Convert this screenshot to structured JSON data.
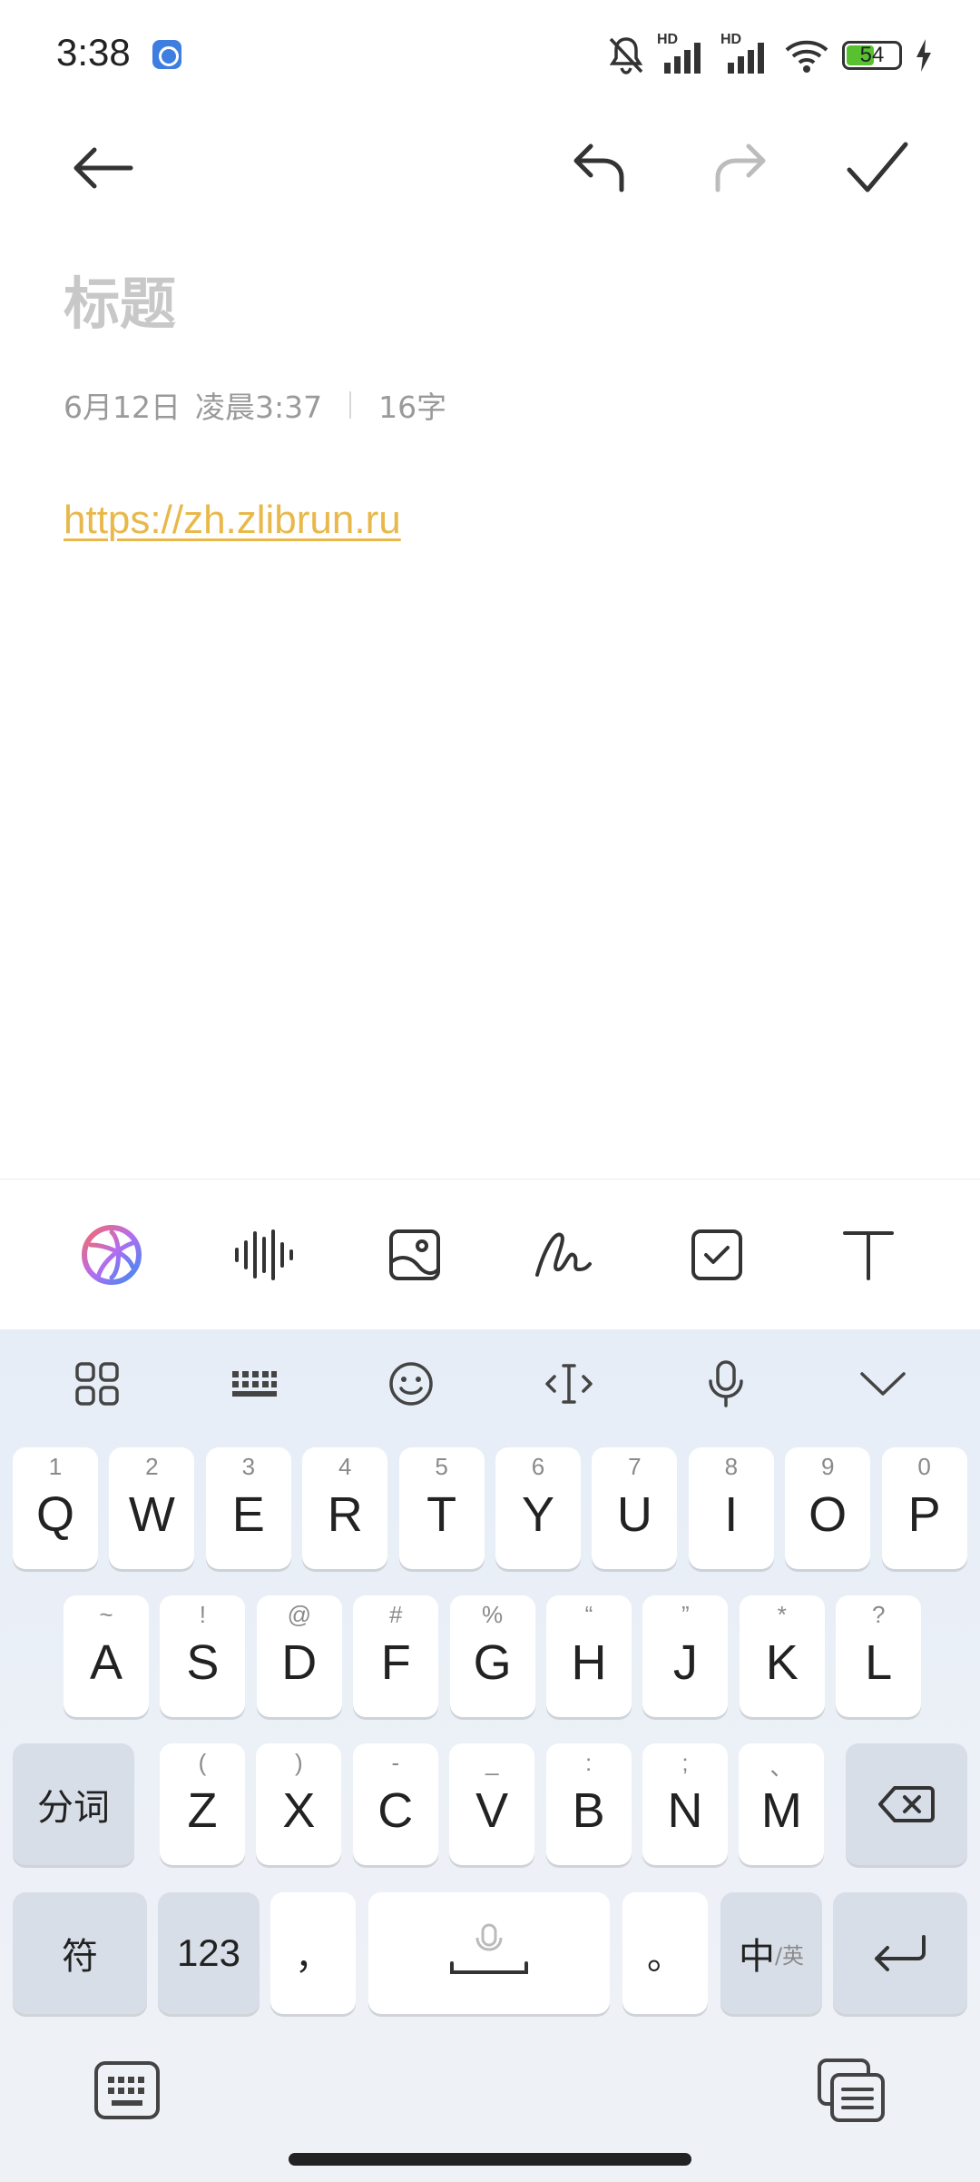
{
  "status_bar": {
    "time": "3:38",
    "battery": "54",
    "icons": [
      "app-icon",
      "bell-off-icon",
      "signal-icon",
      "signal-icon",
      "wifi-icon",
      "battery-icon",
      "charging-icon"
    ],
    "signal_labels": [
      "HD",
      "HD"
    ]
  },
  "toolbar": {
    "icons": [
      "back-arrow-icon",
      "undo-icon",
      "redo-icon",
      "check-icon"
    ]
  },
  "note": {
    "title_placeholder": "标题",
    "date": "6月12日",
    "time": "凌晨3:37",
    "char_count": "16字",
    "body_link": "https://zh.zlibrun.ru"
  },
  "edit_tools": [
    "ai-assistant-icon",
    "voice-wave-icon",
    "image-icon",
    "handwriting-icon",
    "checklist-icon",
    "text-format-icon"
  ],
  "keyboard": {
    "top_icons": [
      "grid-menu-icon",
      "keyboard-layout-icon",
      "emoji-icon",
      "cursor-icon",
      "microphone-icon",
      "collapse-icon"
    ],
    "row1": [
      {
        "k": "Q",
        "s": "1"
      },
      {
        "k": "W",
        "s": "2"
      },
      {
        "k": "E",
        "s": "3"
      },
      {
        "k": "R",
        "s": "4"
      },
      {
        "k": "T",
        "s": "5"
      },
      {
        "k": "Y",
        "s": "6"
      },
      {
        "k": "U",
        "s": "7"
      },
      {
        "k": "I",
        "s": "8"
      },
      {
        "k": "O",
        "s": "9"
      },
      {
        "k": "P",
        "s": "0"
      }
    ],
    "row2": [
      {
        "k": "A",
        "s": "~"
      },
      {
        "k": "S",
        "s": "!"
      },
      {
        "k": "D",
        "s": "@"
      },
      {
        "k": "F",
        "s": "#"
      },
      {
        "k": "G",
        "s": "%"
      },
      {
        "k": "H",
        "s": "“"
      },
      {
        "k": "J",
        "s": "”"
      },
      {
        "k": "K",
        "s": "*"
      },
      {
        "k": "L",
        "s": "?"
      }
    ],
    "row3": [
      {
        "k": "Z",
        "s": "("
      },
      {
        "k": "X",
        "s": ")"
      },
      {
        "k": "C",
        "s": "-"
      },
      {
        "k": "V",
        "s": "_"
      },
      {
        "k": "B",
        "s": ":"
      },
      {
        "k": "N",
        "s": ";"
      },
      {
        "k": "M",
        "s": "、"
      }
    ],
    "segment_label": "分词",
    "symbols_label": "符",
    "numbers_label": "123",
    "comma_label": "，",
    "period_label": "。",
    "lang_main": "中",
    "lang_sub": "/英"
  }
}
